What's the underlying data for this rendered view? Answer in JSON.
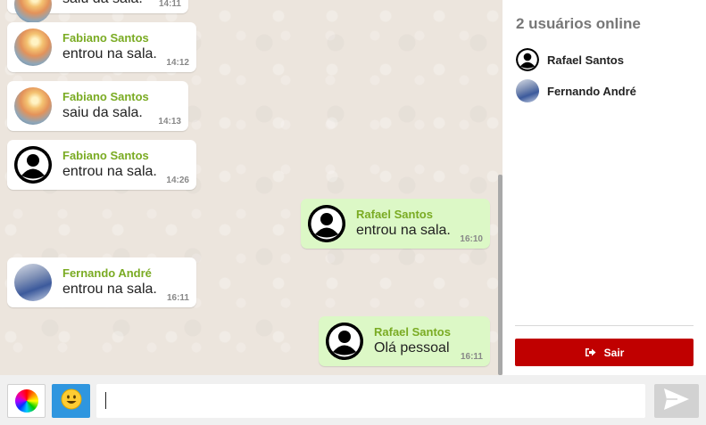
{
  "messages": [
    {
      "sender": "",
      "text": "saiu da sala.",
      "time": "14:11",
      "direction": "in",
      "avatar": "photo-sunset"
    },
    {
      "sender": "Fabiano Santos",
      "text": "entrou na sala.",
      "time": "14:12",
      "direction": "in",
      "avatar": "photo-sunset"
    },
    {
      "sender": "Fabiano Santos",
      "text": "saiu da sala.",
      "time": "14:13",
      "direction": "in",
      "avatar": "photo-sunset"
    },
    {
      "sender": "Fabiano Santos",
      "text": "entrou na sala.",
      "time": "14:26",
      "direction": "in",
      "avatar": "default-user-icon"
    },
    {
      "sender": "Rafael Santos",
      "text": "entrou na sala.",
      "time": "16:10",
      "direction": "out",
      "avatar": "default-user-icon"
    },
    {
      "sender": "Fernando André",
      "text": "entrou na sala.",
      "time": "16:11",
      "direction": "in",
      "avatar": "photo-car"
    },
    {
      "sender": "Rafael Santos",
      "text": "Olá pessoal",
      "time": "16:11",
      "direction": "out",
      "avatar": "default-user-icon"
    }
  ],
  "sidebar": {
    "title": "2 usuários online",
    "users": [
      {
        "name": "Rafael Santos",
        "avatar": "default-user-icon"
      },
      {
        "name": "Fernando André",
        "avatar": "photo-car"
      }
    ],
    "logout_label": "Sair",
    "logout_icon": "sign-out-icon"
  },
  "input_bar": {
    "color_picker_icon": "color-wheel-icon",
    "emoji_icon": "smiley-icon",
    "message_value": "",
    "send_icon": "send-arrow-icon"
  },
  "colors": {
    "sender_name": "#7aab23",
    "outgoing_bubble": "#dcf8c6",
    "incoming_bubble": "#ffffff",
    "logout_button": "#c00000",
    "emoji_button": "#2f96df",
    "chat_background": "#ece5dd"
  }
}
